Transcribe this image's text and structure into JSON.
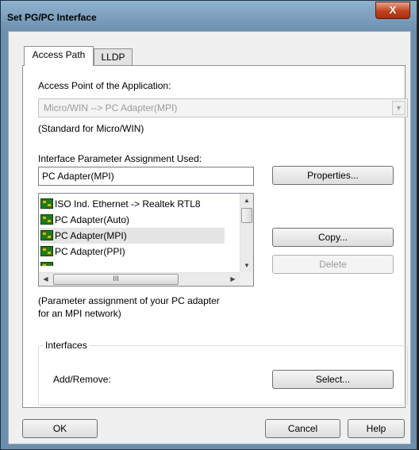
{
  "window": {
    "title": "Set PG/PC Interface",
    "close_glyph": "X"
  },
  "tabs": [
    {
      "label": "Access Path"
    },
    {
      "label": "LLDP"
    }
  ],
  "access_point": {
    "label": "Access Point of the Application:",
    "value": "Micro/WIN      --> PC Adapter(MPI)",
    "note": "(Standard for Micro/WIN)"
  },
  "interface": {
    "label": "Interface Parameter Assignment Used:",
    "value": "PC Adapter(MPI)",
    "items": [
      {
        "label": "ISO Ind. Ethernet -> Realtek RTL8"
      },
      {
        "label": "PC Adapter(Auto)"
      },
      {
        "label": "PC Adapter(MPI)"
      },
      {
        "label": "PC Adapter(PPI)"
      }
    ],
    "selected_index": 2,
    "hscroll_grip": "III",
    "description_line1": "(Parameter assignment of your PC adapter",
    "description_line2": "for an MPI network)"
  },
  "buttons": {
    "properties": "Properties...",
    "copy": "Copy...",
    "delete": "Delete",
    "select": "Select...",
    "ok": "OK",
    "cancel": "Cancel",
    "help": "Help"
  },
  "interfaces_group": {
    "legend": "Interfaces",
    "add_remove": "Add/Remove:"
  },
  "colors": {
    "title_bar": "#7a9cbc",
    "close_button": "#c2421f",
    "dialog_bg": "#f0f0f0"
  }
}
